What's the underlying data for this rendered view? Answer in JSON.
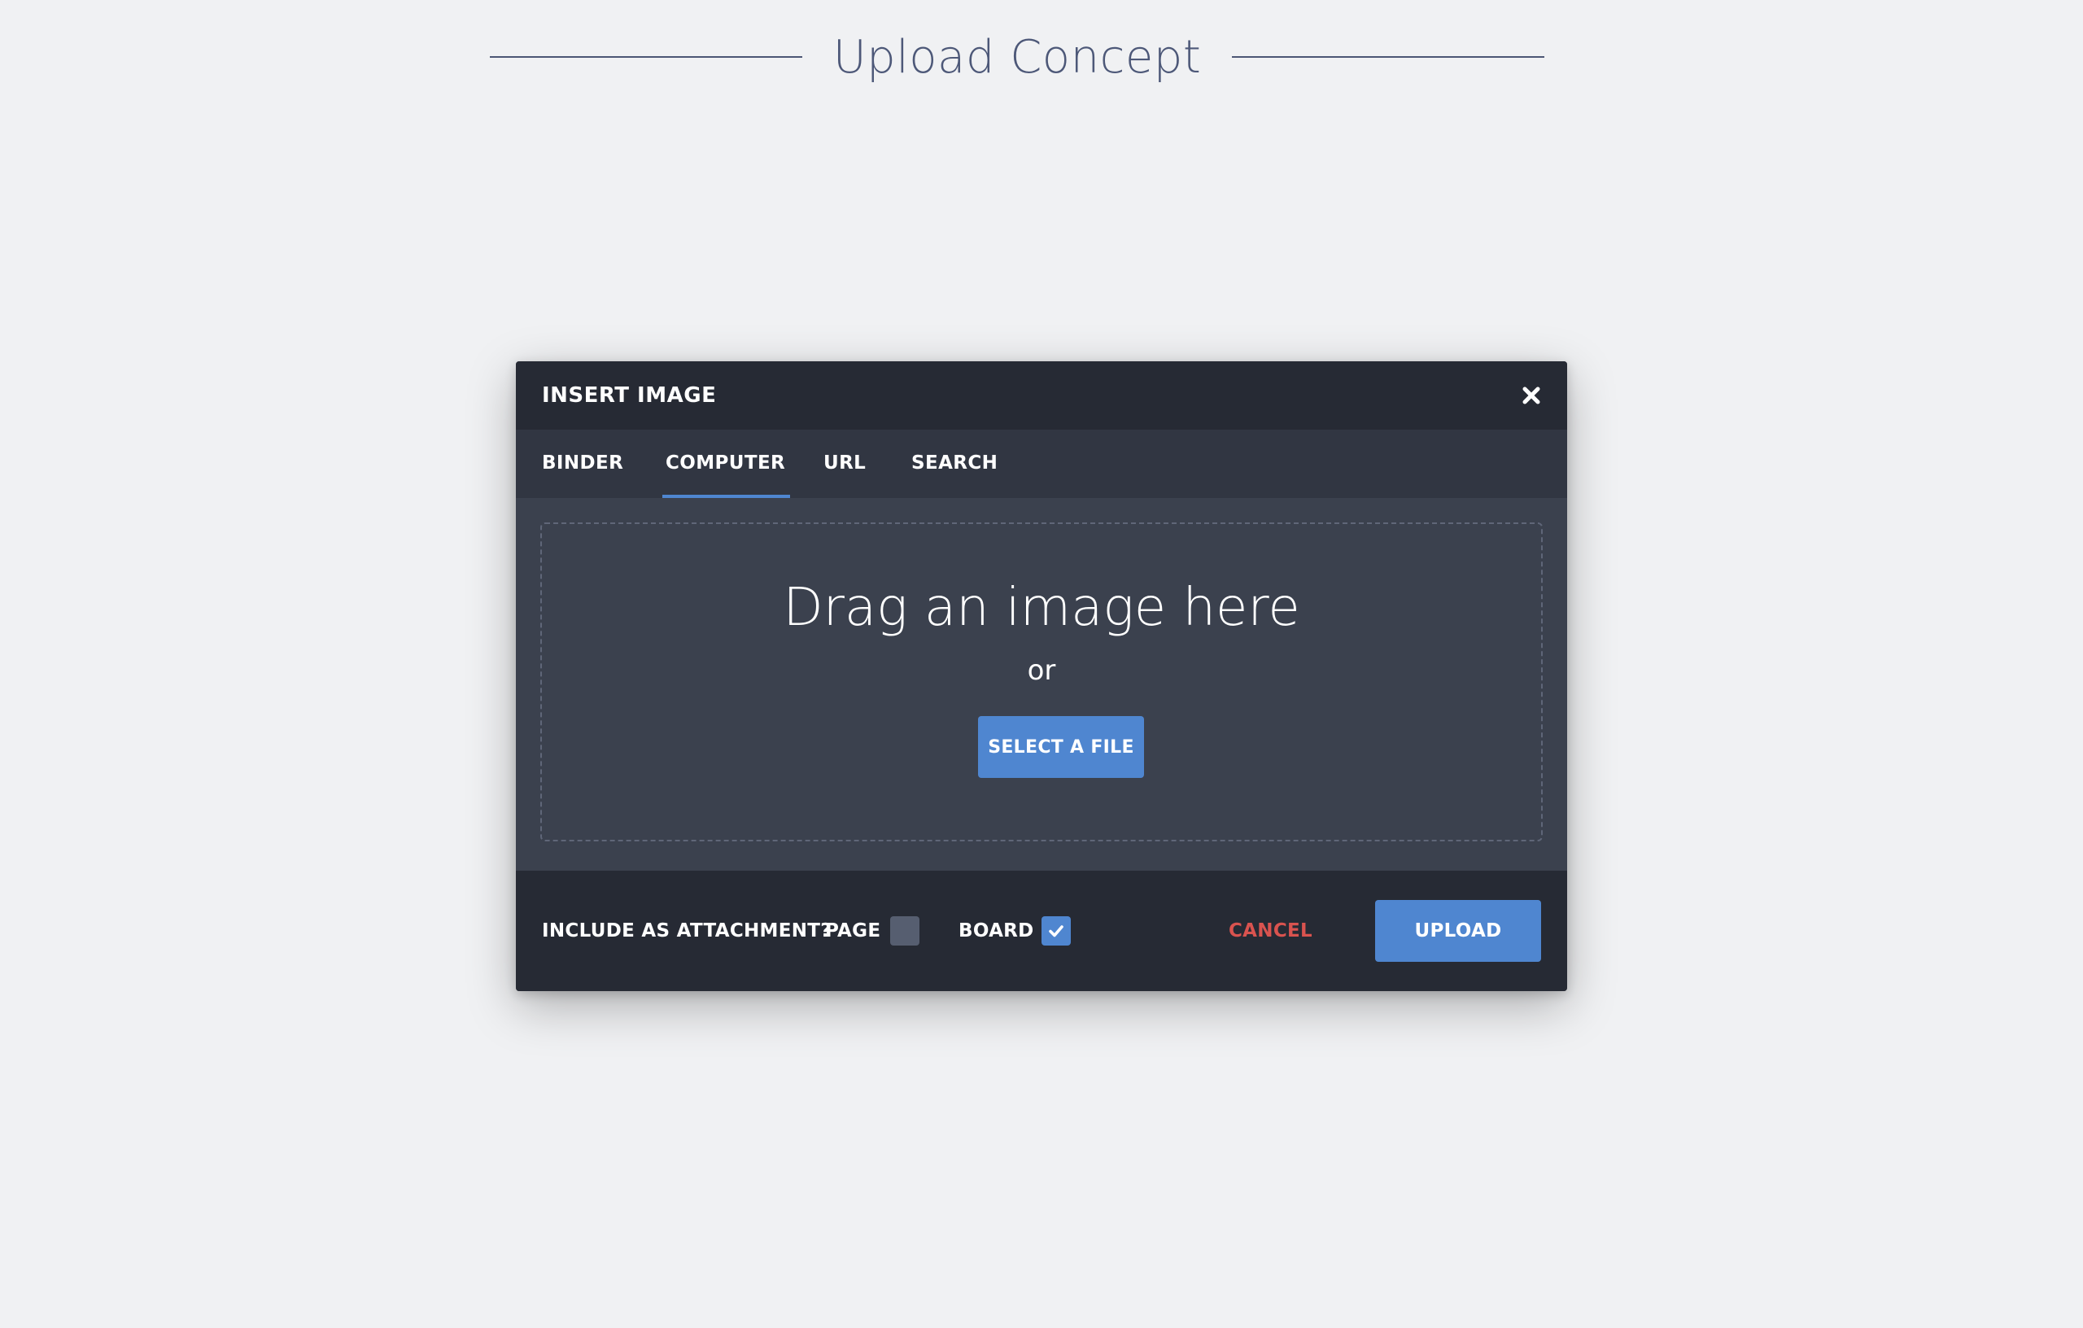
{
  "page": {
    "title": "Upload Concept"
  },
  "modal": {
    "title": "INSERT IMAGE",
    "close_icon": "close-icon",
    "tabs": [
      {
        "label": "BINDER",
        "active": false
      },
      {
        "label": "COMPUTER",
        "active": true
      },
      {
        "label": "URL",
        "active": false
      },
      {
        "label": "SEARCH",
        "active": false
      }
    ],
    "dropzone": {
      "title": "Drag an image here",
      "or": "or",
      "select_label": "SELECT A FILE"
    },
    "footer": {
      "attachment_label": "INCLUDE AS ATTACHMENT?",
      "page_label": "PAGE",
      "page_checked": false,
      "board_label": "BOARD",
      "board_checked": true,
      "cancel_label": "CANCEL",
      "upload_label": "UPLOAD"
    }
  },
  "colors": {
    "accent": "#4f86d0",
    "cancel": "#d9534f",
    "background": "#f0f1f3",
    "modal_dark": "#262a34",
    "modal_body": "#3b414e"
  }
}
